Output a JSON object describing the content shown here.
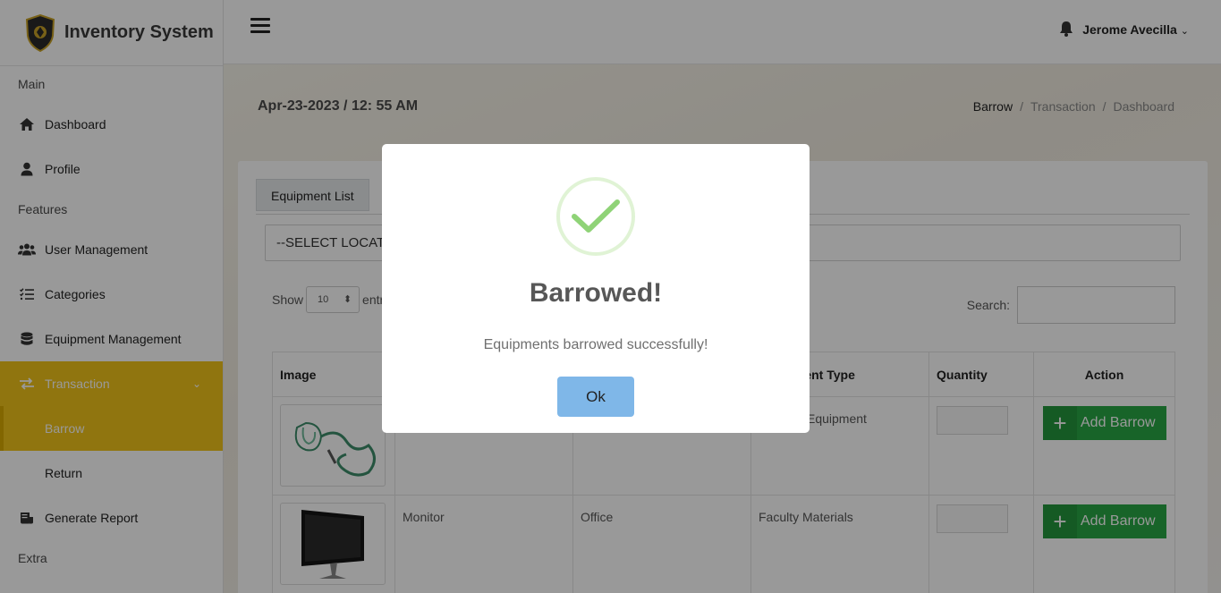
{
  "app": {
    "title": "Inventory System"
  },
  "sidebar": {
    "sections": {
      "main": "Main",
      "features": "Features",
      "extra": "Extra"
    },
    "items": {
      "dashboard": "Dashboard",
      "profile": "Profile",
      "user_management": "User Management",
      "categories": "Categories",
      "equipment_management": "Equipment Management",
      "transaction": "Transaction",
      "barrow": "Barrow",
      "return": "Return",
      "generate_report": "Generate Report"
    },
    "active_color": "#f0c419"
  },
  "header": {
    "user_name": "Jerome Avecilla"
  },
  "page": {
    "datetime": "Apr-23-2023 / 12: 55 AM",
    "breadcrumb": [
      "Barrow",
      "Transaction",
      "Dashboard"
    ],
    "tab_label": "Equipment List",
    "location_select": "--SELECT LOCATION--",
    "show_label": "Show",
    "entries_value": "10",
    "entries_label": "entries",
    "search_label": "Search:"
  },
  "table": {
    "headers": {
      "image": "Image",
      "equipment_type": "Equipment Type",
      "quantity": "Quantity",
      "action": "Action"
    },
    "rows": [
      {
        "name": "",
        "location": "",
        "type": "Equipment",
        "action": "Add Barrow"
      },
      {
        "name": "Monitor",
        "location": "Office",
        "type": "Faculty Materials",
        "action": "Add Barrow"
      }
    ]
  },
  "modal": {
    "title": "Barrowed!",
    "message": "Equipments barrowed successfully!",
    "ok_label": "Ok"
  }
}
